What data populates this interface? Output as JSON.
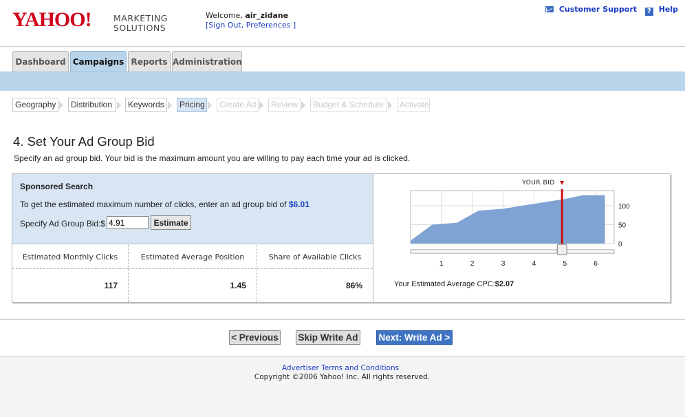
{
  "header": {
    "logo": "YAHOO!",
    "logo_sub_1": "MARKETING",
    "logo_sub_2": "SOLUTIONS",
    "welcome_prefix": "Welcome,",
    "username": "air_zidane",
    "links_text": "[Sign Out, Preferences ]",
    "customer_support": "Customer Support",
    "help": "Help"
  },
  "tabs": [
    {
      "label": "Dashboard",
      "active": false
    },
    {
      "label": "Campaigns",
      "active": true
    },
    {
      "label": "Reports",
      "active": false
    },
    {
      "label": "Administration",
      "active": false
    }
  ],
  "steps": [
    {
      "label": "Geography",
      "state": "done"
    },
    {
      "label": "Distribution",
      "state": "done"
    },
    {
      "label": "Keywords",
      "state": "done"
    },
    {
      "label": "Pricing",
      "state": "active"
    },
    {
      "label": "Create Ad",
      "state": "disabled"
    },
    {
      "label": "Review",
      "state": "disabled"
    },
    {
      "label": "Budget & Schedule",
      "state": "disabled"
    },
    {
      "label": "Activate",
      "state": "disabled"
    }
  ],
  "page": {
    "title": "4. Set Your Ad Group Bid",
    "description": "Specify an ad group bid. Your bid is the maximum amount you are willing to pay each time your ad is clicked."
  },
  "sponsored": {
    "title": "Sponsored Search",
    "text": "To get the estimated maximum number of clicks, enter an ad group bid of",
    "suggested_bid": "$6.01",
    "bid_label": "Specify Ad Group Bid:$",
    "bid_value": "4.91",
    "estimate_button": "Estimate"
  },
  "stats": [
    {
      "label": "Estimated Monthly Clicks",
      "value": "117"
    },
    {
      "label": "Estimated Average Position",
      "value": "1.45"
    },
    {
      "label": "Share of Available Clicks",
      "value": "86%"
    }
  ],
  "chart_data": {
    "type": "area",
    "marker_label": "YOUR BID",
    "marker_x": 4.91,
    "x": [
      0,
      0.7,
      1.5,
      2.2,
      3,
      4,
      5,
      5.6,
      6.3
    ],
    "values": [
      8,
      50,
      55,
      87,
      92,
      105,
      118,
      128,
      128
    ],
    "xticks": [
      "1",
      "2",
      "3",
      "4",
      "5",
      "6"
    ],
    "xtick_values": [
      1,
      2,
      3,
      4,
      5,
      6
    ],
    "yticks": [
      "100",
      "50",
      "0"
    ],
    "ytick_values": [
      100,
      50,
      0
    ],
    "xlim": [
      0,
      6.6
    ],
    "ylim": [
      0,
      140
    ],
    "fill_color": "#7fa3d2",
    "marker_color": "#cc1111"
  },
  "cpc_label": "Your Estimated Average CPC:",
  "cpc_value": "$2.07",
  "buttons": {
    "previous": "< Previous",
    "skip": "Skip Write Ad",
    "next": "Next: Write Ad >"
  },
  "footer": {
    "terms": "Advertiser Terms and Conditions",
    "copyright": "Copyright ©2006 Yahoo! Inc. All rights reserved."
  },
  "colors": {
    "link": "#1a3cc4",
    "brand_red": "#d0021b",
    "tab_active": "#b9d5eb"
  }
}
